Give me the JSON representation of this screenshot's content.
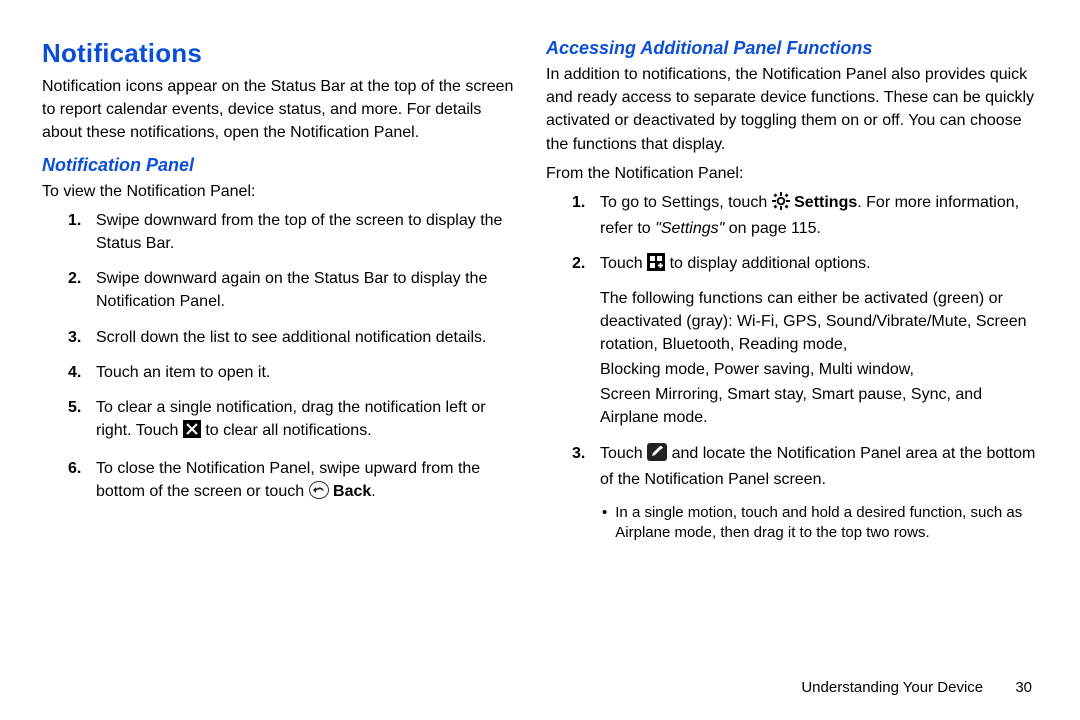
{
  "left": {
    "heading": "Notifications",
    "intro": "Notification icons appear on the Status Bar at the top of the screen to report calendar events, device status, and more. For details about these notifications, open the Notification Panel.",
    "sub_heading": "Notification Panel",
    "lead": "To view the Notification Panel:",
    "steps": {
      "n1": "1.",
      "s1": "Swipe downward from the top of the screen to display the Status Bar.",
      "n2": "2.",
      "s2": "Swipe downward again on the Status Bar to display the Notification Panel.",
      "n3": "3.",
      "s3": "Scroll down the list to see additional notification details.",
      "n4": "4.",
      "s4": "Touch an item to open it.",
      "n5": "5.",
      "s5a": "To clear a single notification, drag the notification left or right. Touch ",
      "s5b": " to clear all notifications.",
      "n6": "6.",
      "s6a": "To close the Notification Panel, swipe upward from the bottom of the screen or touch ",
      "back_label": "Back",
      "s6b": "."
    }
  },
  "right": {
    "heading": "Accessing Additional Panel Functions",
    "intro": "In addition to notifications, the Notification Panel also provides quick and ready access to separate device functions. These can be quickly activated or deactivated by toggling them on or off. You can choose the functions that display.",
    "from": "From the Notification Panel:",
    "steps": {
      "n1": "1.",
      "s1a": "To go to Settings, touch ",
      "settings_label": "Settings",
      "s1b": ". For more information, refer to ",
      "settings_ref": "\"Settings\"",
      "s1c": " on page 115.",
      "n2": "2.",
      "s2a": "Touch ",
      "s2b": " to display additional options.",
      "s2p1": "The following functions can either be activated (green) or deactivated (gray): Wi-Fi, GPS, Sound/Vibrate/Mute, Screen rotation, Bluetooth, Reading mode,",
      "s2p2": "Blocking mode, Power saving, Multi window,",
      "s2p3": "Screen Mirroring, Smart stay, Smart pause, Sync, and Airplane mode.",
      "n3": "3.",
      "s3a": "Touch ",
      "s3b": " and locate the Notification Panel area at the bottom of the Notification Panel screen.",
      "bullet": "In a single motion, touch and hold a desired function, such as Airplane mode, then drag it to the top two rows."
    }
  },
  "footer": {
    "chapter": "Understanding Your Device",
    "page": "30"
  }
}
